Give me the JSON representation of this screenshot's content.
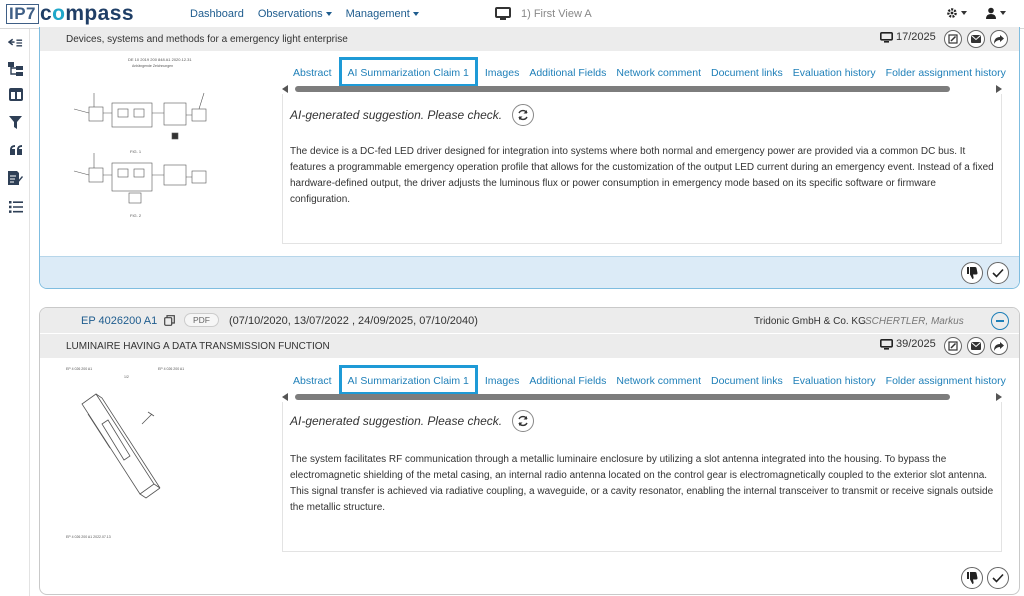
{
  "app": {
    "logo_box": "IP7",
    "logo_pre": "c",
    "logo_hl": "o",
    "logo_post": "mpass"
  },
  "nav": {
    "dashboard": "Dashboard",
    "observations": "Observations",
    "management": "Management",
    "view_label": "1) First View A"
  },
  "card1": {
    "title": "Devices, systems and methods for a emergency light enterprise",
    "counter": "17/2025",
    "thumb_header": "DE 10 2019 200 848 A1   2020.12.31",
    "thumb_sub": "Anhängende Zeichnungen",
    "fig1": "FIG. 1",
    "fig2": "FIG. 2",
    "tabs": [
      "Abstract",
      "AI Summarization Claim 1",
      "Images",
      "Additional Fields",
      "Network comment",
      "Document links",
      "Evaluation history",
      "Folder assignment history"
    ],
    "ai_label": "AI-generated suggestion. Please check.",
    "summary": "The device is a DC-fed LED driver designed for integration into systems where both normal and emergency power are provided via a common DC bus. It features a programmable emergency operation profile that allows for the customization of the output LED current during an emergency event. Instead of a fixed hardware-defined output, the driver adjusts the luminous flux or power consumption in emergency mode based on its specific software or firmware configuration."
  },
  "card2": {
    "pub_number": "EP 4026200 A1",
    "pdf_label": "PDF",
    "dates": "(07/10/2020, 13/07/2022 , 24/09/2025, 07/10/2040)",
    "applicant": "Tridonic GmbH & Co. KG",
    "inventor": "SCHERTLER, Markus",
    "title": "LUMINAIRE HAVING A DATA TRANSMISSION FUNCTION",
    "counter": "39/2025",
    "thumb_left": "EP 4 026 200 A1",
    "thumb_right": "EP 4 026 200 A1",
    "thumb_fig": "1/2",
    "thumb_footer": "EP 4 026 200 A1  2022.07.13",
    "tabs": [
      "Abstract",
      "AI Summarization Claim 1",
      "Images",
      "Additional Fields",
      "Network comment",
      "Document links",
      "Evaluation history",
      "Folder assignment history"
    ],
    "ai_label": "AI-generated suggestion. Please check.",
    "summary": "The system facilitates RF communication through a metallic luminaire enclosure by utilizing a slot antenna integrated into the housing. To bypass the electromagnetic shielding of the metal casing, an internal radio antenna located on the control gear is electromagnetically coupled to the exterior slot antenna. This signal transfer is achieved via radiative coupling, a waveguide, or a cavity resonator, enabling the internal transceiver to transmit or receive signals outside the metallic structure."
  },
  "colors": {
    "link": "#1e7fb8",
    "active_tab_border": "#1e9ad6",
    "card1_footer": "#dcebf7"
  }
}
